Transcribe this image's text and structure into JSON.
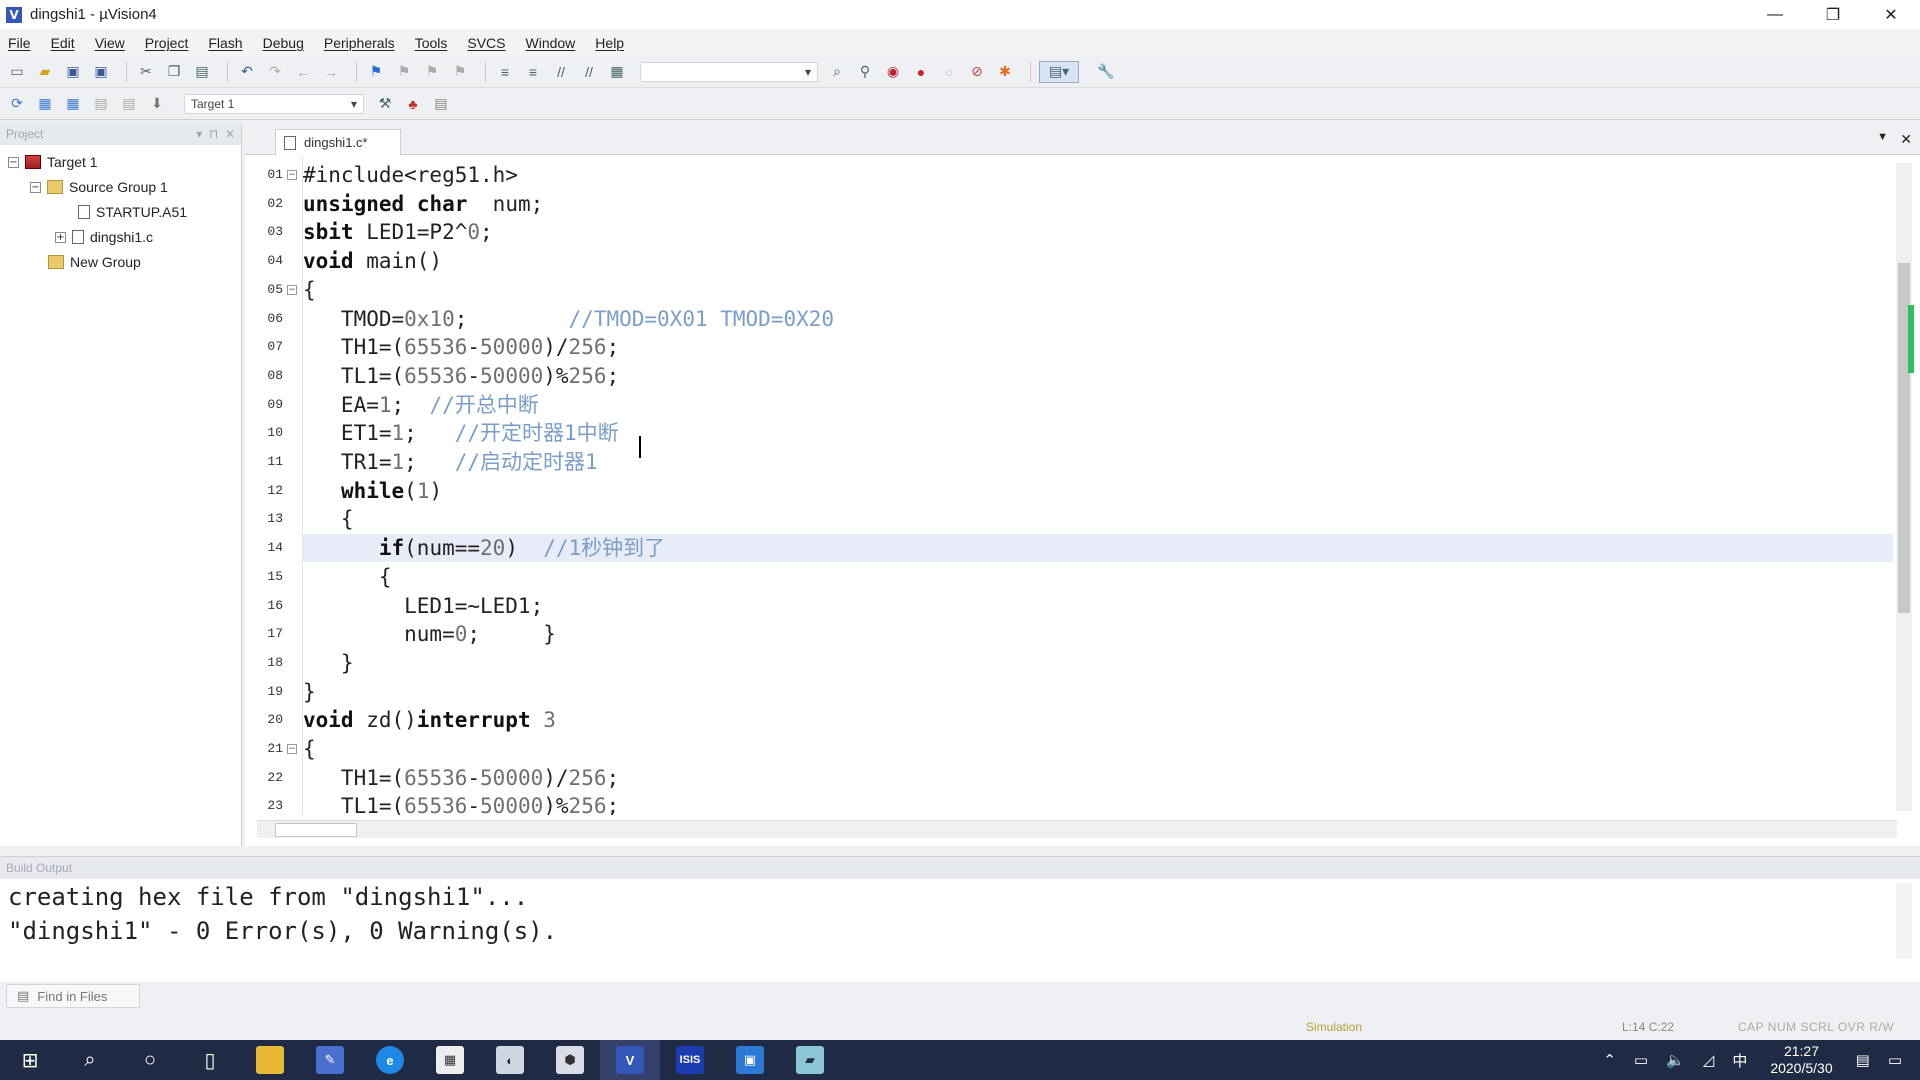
{
  "window": {
    "title": "dingshi1 - µVision4",
    "minimize": "—",
    "maximize": "❐",
    "close": "✕"
  },
  "menu": [
    "File",
    "Edit",
    "View",
    "Project",
    "Flash",
    "Debug",
    "Peripherals",
    "Tools",
    "SVCS",
    "Window",
    "Help"
  ],
  "toolbar2": {
    "target_combo": "Target 1"
  },
  "project_panel": {
    "header": "Project",
    "tree": [
      {
        "label": "Target 1",
        "level": 0,
        "toggle": "−",
        "icon": "target"
      },
      {
        "label": "Source Group 1",
        "level": 1,
        "toggle": "−",
        "icon": "folder"
      },
      {
        "label": "STARTUP.A51",
        "level": 2,
        "toggle": "",
        "icon": "file"
      },
      {
        "label": "dingshi1.c",
        "level": 2,
        "toggle": "+",
        "icon": "file"
      },
      {
        "label": "New Group",
        "level": 1,
        "toggle": "",
        "icon": "folder"
      }
    ]
  },
  "editor": {
    "tab_label": "dingshi1.c*",
    "lines": [
      {
        "n": "01",
        "fold": "−",
        "code": "#include<reg51.h>"
      },
      {
        "n": "02",
        "fold": "",
        "code": "unsigned char  num;"
      },
      {
        "n": "03",
        "fold": "",
        "code": "sbit LED1=P2^0;"
      },
      {
        "n": "04",
        "fold": "",
        "code": "void main()"
      },
      {
        "n": "05",
        "fold": "−",
        "code": "{"
      },
      {
        "n": "06",
        "fold": "",
        "code": "   TMOD=0x10;        //TMOD=0X01 TMOD=0X20"
      },
      {
        "n": "07",
        "fold": "",
        "code": "   TH1=(65536-50000)/256;"
      },
      {
        "n": "08",
        "fold": "",
        "code": "   TL1=(65536-50000)%256;"
      },
      {
        "n": "09",
        "fold": "",
        "code": "   EA=1;  //开总中断"
      },
      {
        "n": "10",
        "fold": "",
        "code": "   ET1=1;   //开定时器1中断"
      },
      {
        "n": "11",
        "fold": "",
        "code": "   TR1=1;   //启动定时器1"
      },
      {
        "n": "12",
        "fold": "",
        "code": "   while(1)"
      },
      {
        "n": "13",
        "fold": "",
        "code": "   {"
      },
      {
        "n": "14",
        "fold": "",
        "code": "      if(num==20)  //1秒钟到了",
        "highlight": true
      },
      {
        "n": "15",
        "fold": "",
        "code": "      {"
      },
      {
        "n": "16",
        "fold": "",
        "code": "        LED1=~LED1;"
      },
      {
        "n": "17",
        "fold": "",
        "code": "        num=0;     }"
      },
      {
        "n": "18",
        "fold": "",
        "code": "   }"
      },
      {
        "n": "19",
        "fold": "",
        "code": "}"
      },
      {
        "n": "20",
        "fold": "",
        "code": "void zd()interrupt 3"
      },
      {
        "n": "21",
        "fold": "−",
        "code": "{"
      },
      {
        "n": "22",
        "fold": "",
        "code": "   TH1=(65536-50000)/256;"
      },
      {
        "n": "23",
        "fold": "",
        "code": "   TL1=(65536-50000)%256;"
      }
    ]
  },
  "build_output": {
    "header": "Build Output",
    "lines": [
      "creating hex file from \"dingshi1\"...",
      "\"dingshi1\" - 0 Error(s), 0 Warning(s)."
    ]
  },
  "bottom_tabs": {
    "find_in_files": "Find in Files"
  },
  "status": {
    "mode": "Simulation",
    "position": "L:14 C:22",
    "keys": "CAP  NUM  SCRL  OVR  R/W"
  },
  "taskbar": {
    "time": "21:27",
    "date": "2020/5/30",
    "ime": "中"
  },
  "colors": {
    "accent": "#3557b7",
    "comment": "#7b9dc9",
    "highlight_line": "#e8ecf8",
    "taskbar": "#1f2a44"
  }
}
